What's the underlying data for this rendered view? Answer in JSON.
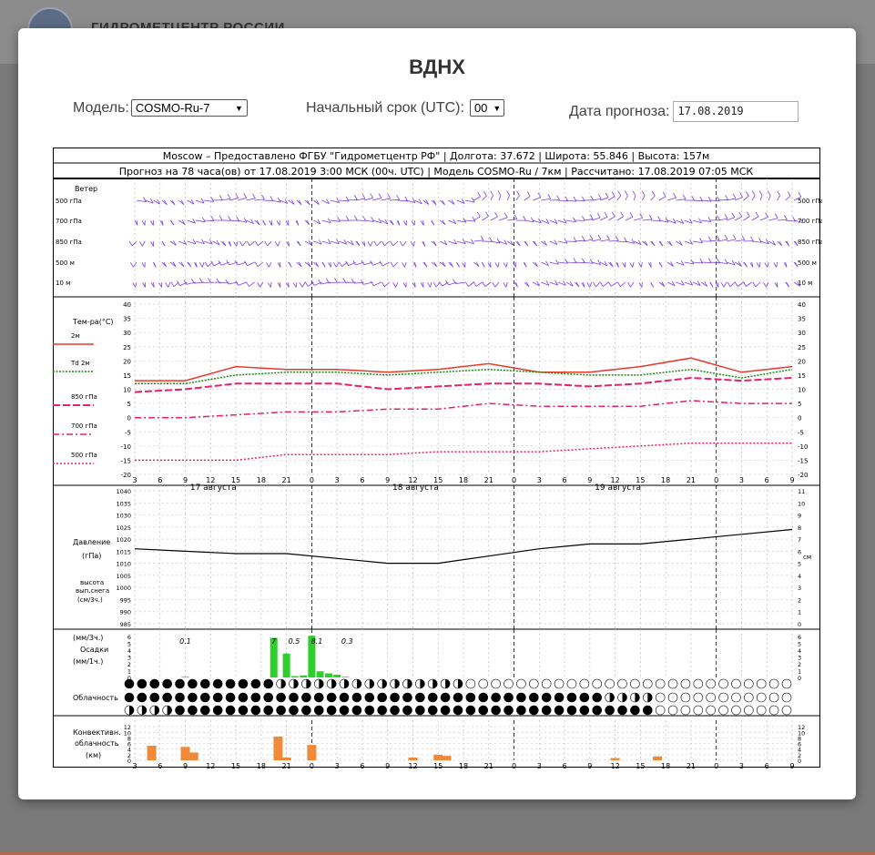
{
  "background": {
    "header_title": "ГИДРОМЕТЦЕНТР РОССИИ"
  },
  "modal": {
    "title": "ВДНХ"
  },
  "controls": {
    "model_label": "Модель:",
    "model_value": "COSMO-Ru-7",
    "start_label": "Начальный срок (UTC):",
    "start_value": "00",
    "date_label": "Дата прогноза:",
    "date_value": "17.08.2019"
  },
  "meteogram": {
    "header_line1": "Moscow – Предоставлено ФГБУ \"Гидрометцентр РФ\" | Долгота: 37.672 | Широта: 55.846 | Высота: 157м",
    "header_line2": "Прогноз на 78 часа(ов) от 17.08.2019 3:00 МСК (00ч. UTC) | Модель COSMO-Ru / 7км | Рассчитано: 17.08.2019 07:05 МСК",
    "wind": {
      "title": "Ветер",
      "levels": [
        "500 гПа",
        "700 гПа",
        "850 гПа",
        "500 м",
        "10 м"
      ]
    },
    "temp": {
      "title": "Тем-ра(°С)",
      "legend": [
        "2м",
        "Td 2м",
        "850 гПа",
        "700 гПа",
        "500 гПа"
      ]
    },
    "pressure": {
      "label1": "Давление",
      "label2": "(гПа)",
      "snow1": "высота",
      "snow2": "вып.снега",
      "snow3": "(см/3ч.)",
      "unit_right": "см"
    },
    "precip": {
      "label1": "(мм/3ч.)",
      "label2": "Осадки",
      "label3": "(мм/1ч.)",
      "annotations": [
        "0.1",
        "7",
        "0.5",
        "8.1",
        "0.3"
      ]
    },
    "cloud": {
      "label": "Облачность"
    },
    "convective": {
      "label1": "Конвективн.",
      "label2": "облачность",
      "label3": "(км)"
    },
    "time_labels": [
      "3",
      "6",
      "9",
      "12",
      "15",
      "18",
      "21",
      "0",
      "3",
      "6",
      "9",
      "12",
      "15",
      "18",
      "21",
      "0",
      "3",
      "6",
      "9",
      "12",
      "15",
      "18",
      "21",
      "0",
      "3",
      "6",
      "9"
    ],
    "day_labels": [
      "17 августа",
      "18 августа",
      "19 августа"
    ]
  },
  "chart_data": [
    {
      "type": "line",
      "title": "Тем-ра(°С)",
      "x": [
        "17.08 03",
        "17.08 09",
        "17.08 15",
        "17.08 21",
        "18.08 03",
        "18.08 09",
        "18.08 15",
        "18.08 21",
        "19.08 03",
        "19.08 09",
        "19.08 15",
        "19.08 21",
        "20.08 03",
        "20.08 09"
      ],
      "series": [
        {
          "name": "2м",
          "values": [
            13,
            13,
            18,
            17,
            17,
            16,
            17,
            19,
            16,
            16,
            18,
            21,
            16,
            18
          ]
        },
        {
          "name": "Td 2м",
          "values": [
            12,
            12,
            15,
            16,
            16,
            15,
            16,
            17,
            16,
            15,
            15,
            17,
            14,
            17
          ]
        },
        {
          "name": "850 гПа",
          "values": [
            9,
            10,
            12,
            12,
            12,
            10,
            11,
            12,
            12,
            11,
            12,
            14,
            13,
            14
          ]
        },
        {
          "name": "700 гПа",
          "values": [
            0,
            0,
            1,
            2,
            2,
            3,
            3,
            5,
            4,
            4,
            4,
            6,
            5,
            5
          ]
        },
        {
          "name": "500 гПа",
          "values": [
            -15,
            -15,
            -15,
            -13,
            -13,
            -13,
            -12,
            -12,
            -12,
            -11,
            -10,
            -9,
            -9,
            -9
          ]
        }
      ],
      "ylim": [
        -20,
        40
      ]
    },
    {
      "type": "line",
      "title": "Давление",
      "x": [
        "17.08 03",
        "17.08 09",
        "17.08 15",
        "17.08 21",
        "18.08 03",
        "18.08 09",
        "18.08 15",
        "18.08 21",
        "19.08 03",
        "19.08 09",
        "19.08 15",
        "19.08 21",
        "20.08 03",
        "20.08 09"
      ],
      "series": [
        {
          "name": "Давление",
          "values": [
            1016,
            1015,
            1014,
            1014,
            1012,
            1010,
            1010,
            1013,
            1016,
            1018,
            1018,
            1020,
            1022,
            1024
          ]
        }
      ],
      "ylim": [
        985,
        1040
      ]
    },
    {
      "type": "bar",
      "title": "Осадки",
      "x": [
        "17.08 09",
        "17.08 20",
        "17.08 21",
        "17.08 22",
        "17.08 23",
        "18.08 00",
        "18.08 01",
        "18.08 02",
        "18.08 03",
        "18.08 04"
      ],
      "values": [
        0.1,
        5.8,
        3.5,
        0.2,
        0.3,
        6.1,
        0.9,
        0.6,
        0.4,
        0.1
      ],
      "ylim": [
        0,
        6
      ]
    },
    {
      "type": "bar",
      "title": "Конвективн. облачность",
      "x": [
        "17.08 05",
        "17.08 09",
        "17.08 10",
        "17.08 20",
        "17.08 21",
        "18.08 00",
        "18.08 12",
        "18.08 15",
        "18.08 16",
        "19.08 12",
        "19.08 17"
      ],
      "values": [
        5.2,
        4.8,
        2.8,
        8.5,
        1.0,
        5.5,
        1.0,
        2.0,
        1.6,
        0.8,
        1.4
      ],
      "ylim": [
        0,
        14
      ]
    }
  ],
  "colors": {
    "t2m": "#e8392b",
    "td": "#1a8a1a",
    "t850": "#e8206b",
    "t700": "#e8206b",
    "t500": "#e8206b",
    "wind": "#7b3fe0",
    "precip": "#2bd02b",
    "convective": "#ee8a3a"
  }
}
